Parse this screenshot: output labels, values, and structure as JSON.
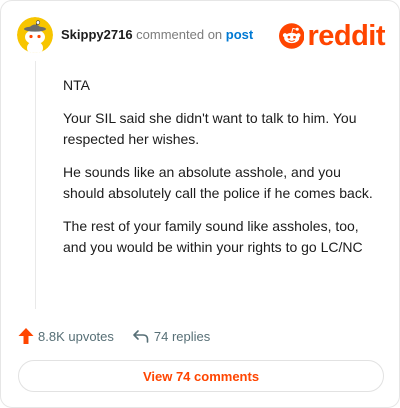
{
  "header": {
    "username": "Skippy2716",
    "verb": "commented on",
    "post_link": "post",
    "logo_text": "reddit"
  },
  "comment": {
    "paragraphs": [
      "NTA",
      "Your SIL said she didn't want to talk to him. You respected her wishes.",
      "He sounds like an absolute asshole, and you should absolutely call the police if he comes back.",
      "The rest of your family sound like assholes, too, and you would be within your rights to go LC/NC"
    ]
  },
  "actions": {
    "upvotes_label": "8.8K upvotes",
    "replies_label": "74 replies"
  },
  "view_comments_label": "View 74 comments",
  "icons": {
    "avatar": "snoo-avatar-icon",
    "logo": "reddit-snoo-icon",
    "upvote": "upvote-arrow-icon",
    "reply": "reply-arrow-icon"
  },
  "colors": {
    "brand": "#ff4500",
    "link": "#0079d3",
    "muted": "#7c7c7c",
    "avatar_bg": "#f7c500"
  }
}
